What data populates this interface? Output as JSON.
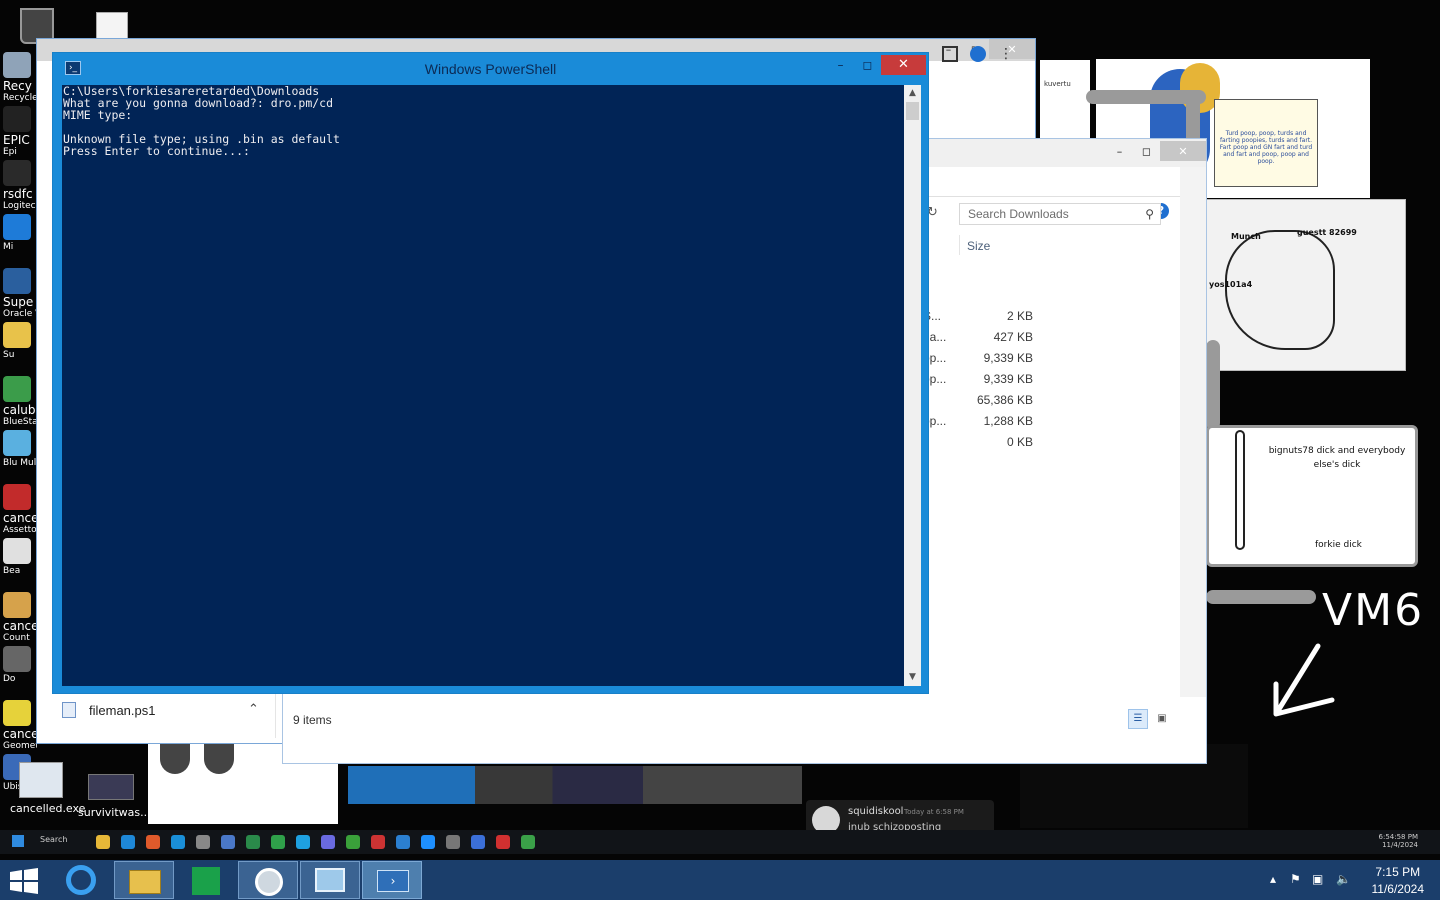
{
  "desktop": {
    "icons": [
      {
        "label": "Recy",
        "sub": "Recycle B",
        "color": "#8fa3b8"
      },
      {
        "label": "EPIC",
        "sub": "Epi",
        "color": "#222222"
      },
      {
        "label": "rsdfc",
        "sub": "Logitech HUB",
        "color": "#2a2a2a"
      },
      {
        "label": "",
        "sub": "Mi",
        "color": "#1e7bd8"
      },
      {
        "label": "Supe",
        "sub": "Oracle VM VirtualBo",
        "color": "#2a5f9e"
      },
      {
        "label": "",
        "sub": "Su",
        "color": "#e8c24a"
      },
      {
        "label": "calub",
        "sub": "BlueStack",
        "color": "#3b9c4a"
      },
      {
        "label": "",
        "sub": "Blu Multi-Ins",
        "color": "#5ab0e0"
      },
      {
        "label": "cance",
        "sub": "Assetto Corsa",
        "color": "#c22b2b"
      },
      {
        "label": "",
        "sub": "Bea",
        "color": "#e0e0e0"
      },
      {
        "label": "cance",
        "sub": "Count",
        "color": "#d6a24b"
      },
      {
        "label": "",
        "sub": "Do",
        "color": "#666666"
      },
      {
        "label": "cance",
        "sub": "Geometry Dash",
        "color": "#e6d23a"
      },
      {
        "label": "",
        "sub": "Ubisoft Connect",
        "color": "#3a6ab8"
      }
    ],
    "files": [
      {
        "label": "cancelled.exe"
      },
      {
        "label": "survivitwas..."
      }
    ]
  },
  "background": {
    "art_note": "Turd poop, poop, turds and farting poopies, turds and fart. Fart poop and GN fart and turd and fart and poop, poop and poop.",
    "art_small": "kuvertu",
    "sketch_labels": [
      "Munch",
      "guestt 82699",
      "yos101a4"
    ],
    "doc_text_1": "bignuts78 dick and everybody else's dick",
    "doc_text_2": "forkie dick",
    "vm6": "VM6",
    "chat": {
      "name": "squidiskool",
      "time": "Today at 6:58 PM",
      "message": "inub schizoposting"
    },
    "inner_taskbar": {
      "search": "Search",
      "time": "6:54:58 PM",
      "date": "11/4/2024"
    }
  },
  "explorer": {
    "search_placeholder": "Search Downloads",
    "column_size": "Size",
    "rows": [
      {
        "name": "S...",
        "size": "2 KB"
      },
      {
        "name": "na...",
        "size": "427 KB"
      },
      {
        "name": "op...",
        "size": "9,339 KB"
      },
      {
        "name": "op...",
        "size": "9,339 KB"
      },
      {
        "name": "",
        "size": "65,386 KB"
      },
      {
        "name": "op...",
        "size": "1,288 KB"
      },
      {
        "name": "",
        "size": "0 KB"
      }
    ],
    "status": "9 items",
    "help": "?"
  },
  "download_bar": {
    "file_name": "fileman.ps1"
  },
  "powershell": {
    "title": "Windows PowerShell",
    "lines": [
      "C:\\Users\\forkiesareretarded\\Downloads",
      "What are you gonna download?: dro.pm/cd",
      "MIME type:",
      "",
      "Unknown file type; using .bin as default",
      "Press Enter to continue...:"
    ]
  },
  "taskbar": {
    "time": "7:15 PM",
    "date": "11/6/2024"
  },
  "colors": {
    "ps_background": "#012456",
    "ps_frame": "#1a8bd8",
    "taskbar": "#1b3e6b",
    "close_red": "#c73b3b"
  }
}
